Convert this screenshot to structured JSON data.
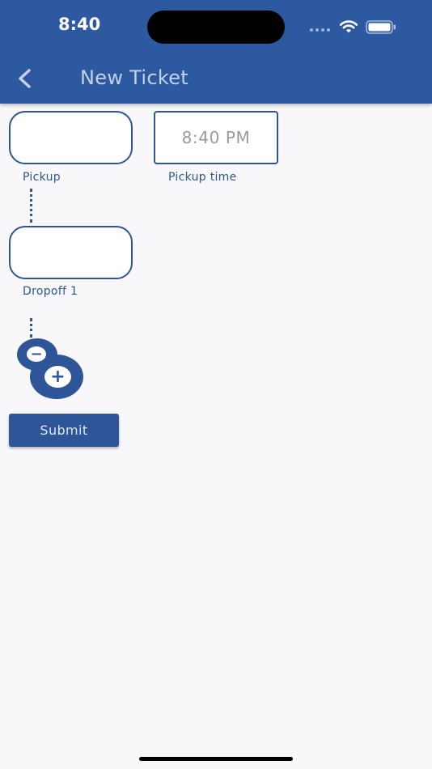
{
  "status_bar": {
    "time": "8:40"
  },
  "nav": {
    "title": "New Ticket",
    "back_icon": "chevron-left-icon"
  },
  "form": {
    "pickup": {
      "label": "Pickup",
      "value": ""
    },
    "pickup_time": {
      "label": "Pickup time",
      "value": "8:40 PM"
    },
    "dropoffs": [
      {
        "label": "Dropoff 1",
        "value": ""
      }
    ],
    "remove_stop_icon": "minus-icon",
    "add_stop_icon": "plus-icon",
    "minus_glyph": "−",
    "plus_glyph": "+",
    "submit_label": "Submit"
  },
  "colors": {
    "brand": "#2d59a0",
    "accent": "#2d5597",
    "background": "#f8f8fa",
    "nav_title": "#c3d1ea"
  }
}
